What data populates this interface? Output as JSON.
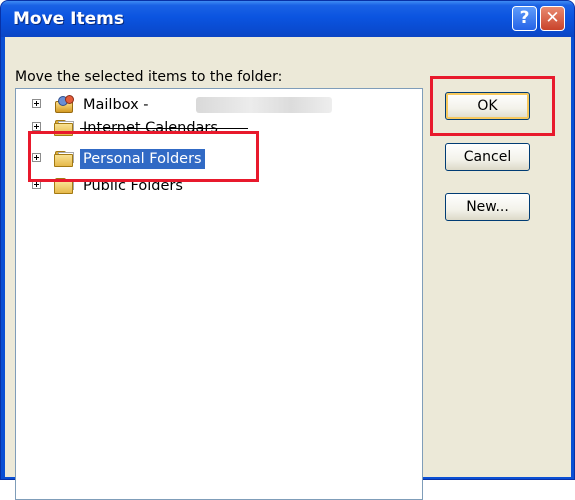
{
  "dialog": {
    "title": "Move Items",
    "help_label": "?",
    "close_label": "✕"
  },
  "prompt": "Move the selected items to the folder:",
  "tree": {
    "items": [
      {
        "label": "Mailbox -",
        "icon": "mailbox-icon",
        "selected": false
      },
      {
        "label": "Internet Calendars",
        "icon": "folder-icon",
        "selected": false
      },
      {
        "label": "Personal Folders",
        "icon": "folder-icon",
        "selected": true
      },
      {
        "label": "Public Folders",
        "icon": "folder-icon",
        "selected": false
      }
    ]
  },
  "buttons": {
    "ok": "OK",
    "cancel": "Cancel",
    "new": "New..."
  },
  "colors": {
    "title_bar": "#0a4fd4",
    "selection": "#316ac5",
    "annotation_red": "#e8192c"
  }
}
